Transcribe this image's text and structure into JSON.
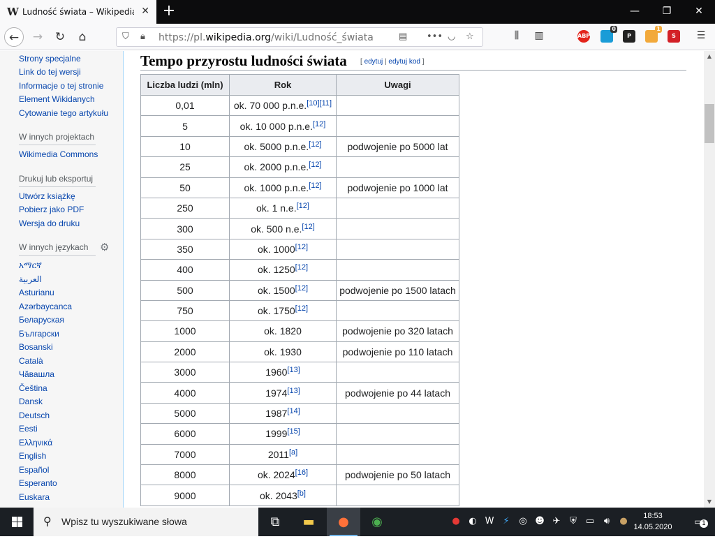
{
  "browser": {
    "tab_title": "Ludność świata – Wikipedia, wolna encyklopedia",
    "tab_favicon": "W",
    "url_prefix": "https://pl.",
    "url_domain": "wikipedia.org",
    "url_path": "/wiki/Ludność_świata",
    "extensions": [
      {
        "name": "abp-icon",
        "label": "ABP",
        "color": "#e3241b"
      },
      {
        "name": "ghostery-icon",
        "label": "",
        "color": "#1a9cd7",
        "badge": "0"
      },
      {
        "name": "p-ext-icon",
        "label": "P",
        "color": "#222222"
      },
      {
        "name": "plane-ext-icon",
        "label": "",
        "color": "#f2a93b",
        "badge": "1"
      },
      {
        "name": "s-ext-icon",
        "label": "S",
        "color": "#d32027"
      }
    ]
  },
  "sidebar": {
    "links_top": [
      "Strony specjalne",
      "Link do tej wersji",
      "Informacje o tej stronie",
      "Element Wikidanych",
      "Cytowanie tego artykułu"
    ],
    "heading_projects": "W innych projektach",
    "links_projects": [
      "Wikimedia Commons"
    ],
    "heading_print": "Drukuj lub eksportuj",
    "links_print": [
      "Utwórz książkę",
      "Pobierz jako PDF",
      "Wersja do druku"
    ],
    "heading_languages": "W innych językach",
    "languages": [
      "አማርኛ",
      "العربية",
      "Asturianu",
      "Azərbaycanca",
      "Беларуская",
      "Български",
      "Bosanski",
      "Català",
      "Чӑвашла",
      "Čeština",
      "Dansk",
      "Deutsch",
      "Eesti",
      "Ελληνικά",
      "English",
      "Español",
      "Esperanto",
      "Euskara"
    ]
  },
  "section": {
    "title": "Tempo przyrostu ludności świata",
    "edit_open": "[ ",
    "edit_label": "edytuj",
    "edit_sep": " | ",
    "edit_code_label": "edytuj kod",
    "edit_close": " ]"
  },
  "table": {
    "headers": [
      "Liczba ludzi (mln)",
      "Rok",
      "Uwagi"
    ],
    "rows": [
      {
        "count": "0,01",
        "year": "ok. 70 000 p.n.e.",
        "refs": "[10][11]",
        "note": ""
      },
      {
        "count": "5",
        "year": "ok. 10 000 p.n.e.",
        "refs": "[12]",
        "note": ""
      },
      {
        "count": "10",
        "year": "ok. 5000 p.n.e.",
        "refs": "[12]",
        "note": "podwojenie po 5000 lat"
      },
      {
        "count": "25",
        "year": "ok. 2000 p.n.e.",
        "refs": "[12]",
        "note": ""
      },
      {
        "count": "50",
        "year": "ok. 1000 p.n.e.",
        "refs": "[12]",
        "note": "podwojenie po 1000 lat"
      },
      {
        "count": "250",
        "year": "ok. 1 n.e.",
        "refs": "[12]",
        "note": ""
      },
      {
        "count": "300",
        "year": "ok. 500 n.e.",
        "refs": "[12]",
        "note": ""
      },
      {
        "count": "350",
        "year": "ok. 1000",
        "refs": "[12]",
        "note": ""
      },
      {
        "count": "400",
        "year": "ok. 1250",
        "refs": "[12]",
        "note": ""
      },
      {
        "count": "500",
        "year": "ok. 1500",
        "refs": "[12]",
        "note": "podwojenie po 1500 latach"
      },
      {
        "count": "750",
        "year": "ok. 1750",
        "refs": "[12]",
        "note": ""
      },
      {
        "count": "1000",
        "year": "ok. 1820",
        "refs": "",
        "note": "podwojenie po 320 latach"
      },
      {
        "count": "2000",
        "year": "ok. 1930",
        "refs": "",
        "note": "podwojenie po 110 latach"
      },
      {
        "count": "3000",
        "year": "1960",
        "refs": "[13]",
        "note": ""
      },
      {
        "count": "4000",
        "year": "1974",
        "refs": "[13]",
        "note": "podwojenie po 44 latach"
      },
      {
        "count": "5000",
        "year": "1987",
        "refs": "[14]",
        "note": ""
      },
      {
        "count": "6000",
        "year": "1999",
        "refs": "[15]",
        "note": ""
      },
      {
        "count": "7000",
        "year": "2011",
        "refs": "[a]",
        "note": ""
      },
      {
        "count": "8000",
        "year": "ok. 2024",
        "refs": "[16]",
        "note": "podwojenie po 50 latach"
      },
      {
        "count": "9000",
        "year": "ok. 2043",
        "refs": "[b]",
        "note": ""
      }
    ]
  },
  "taskbar": {
    "search_placeholder": "Wpisz tu wyszukiwane słowa",
    "time": "18:53",
    "date": "14.05.2020",
    "notification_count": "1"
  }
}
